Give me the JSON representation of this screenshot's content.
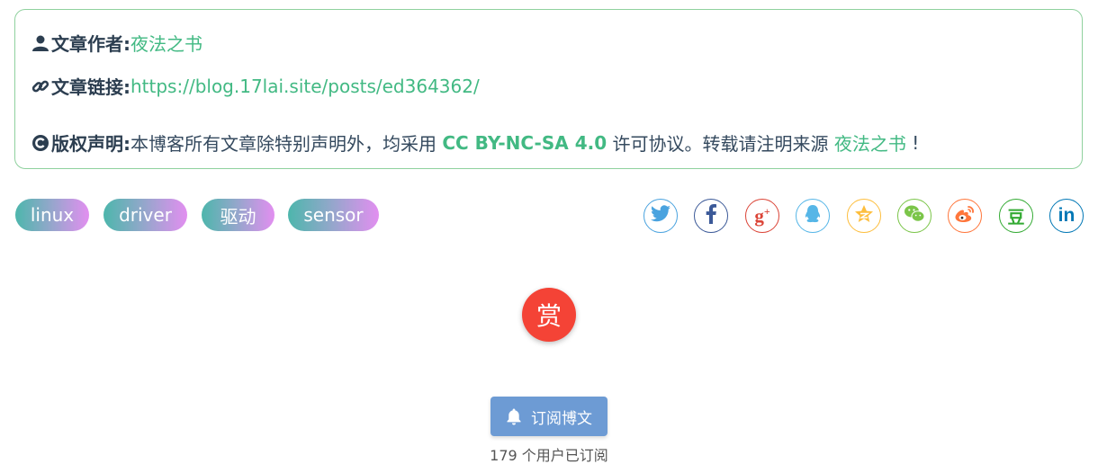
{
  "copyright": {
    "author_label": "文章作者:",
    "author_name": "夜法之书",
    "link_label": "文章链接:",
    "link_url": "https://blog.17lai.site/posts/ed364362/",
    "license_label": "版权声明:",
    "license_text_1": "本博客所有文章除特别声明外，均采用 ",
    "license_name": "CC BY-NC-SA 4.0",
    "license_text_2": " 许可协议。转载请注明来源 ",
    "license_source": "夜法之书",
    "license_end": " !"
  },
  "tags": [
    "linux",
    "driver",
    "驱动",
    "sensor"
  ],
  "share": {
    "icons": [
      "twitter-icon",
      "facebook-icon",
      "google-plus-icon",
      "qq-icon",
      "qzone-icon",
      "wechat-icon",
      "weibo-icon",
      "douban-icon",
      "linkedin-icon"
    ],
    "colors": {
      "twitter": "#4aa3df",
      "facebook": "#3b5998",
      "google": "#db4437",
      "qq": "#56b6e7",
      "qzone": "#fdbe3d",
      "wechat": "#7bc549",
      "weibo": "#ff763b",
      "douban": "#33aa33",
      "linkedin": "#0077b5"
    }
  },
  "reward": {
    "label": "赏"
  },
  "subscribe": {
    "label": "订阅博文",
    "count_text": "179 个用户已订阅"
  }
}
